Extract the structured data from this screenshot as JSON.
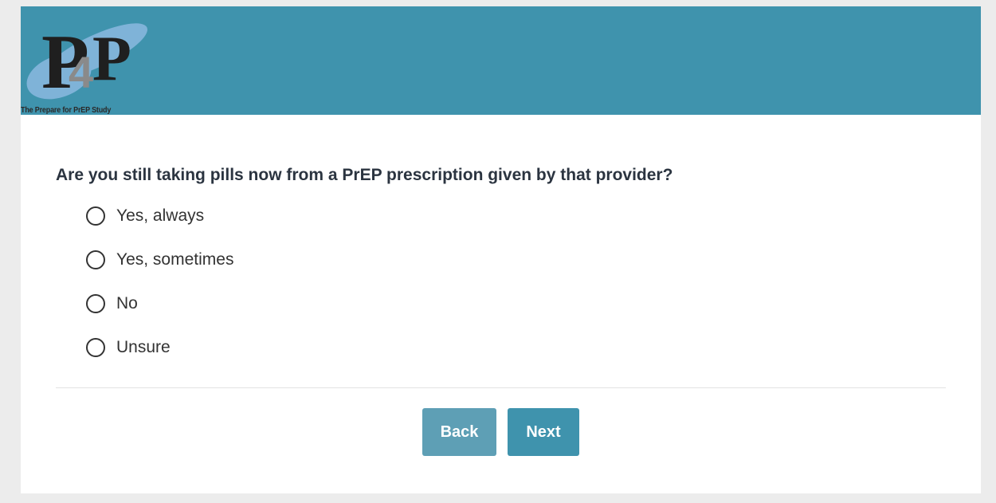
{
  "header": {
    "logo_tagline": "The Prepare for PrEP Study",
    "brand_color": "#3f93ad",
    "logo_icon": "p4p-logo-icon"
  },
  "survey": {
    "question": "Are you still taking pills now from a PrEP prescription given by that provider?",
    "options": [
      "Yes, always",
      "Yes, sometimes",
      "No",
      "Unsure"
    ],
    "selected": null
  },
  "navigation": {
    "back_label": "Back",
    "next_label": "Next"
  }
}
